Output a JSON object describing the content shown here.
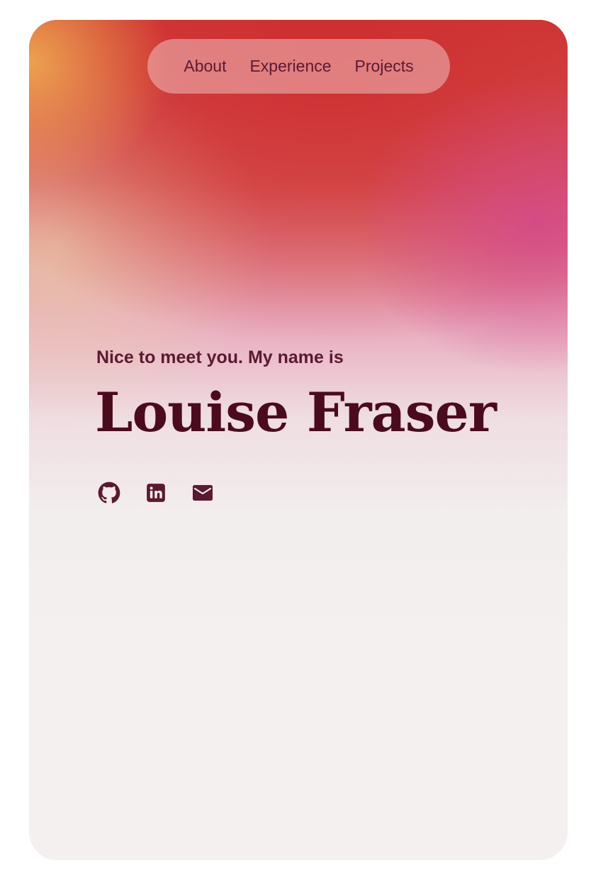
{
  "nav": {
    "items": [
      {
        "label": "About"
      },
      {
        "label": "Experience"
      },
      {
        "label": "Projects"
      }
    ]
  },
  "hero": {
    "greeting": "Nice to meet you. My name is",
    "name": "Louise Fraser"
  },
  "socials": {
    "icons": [
      "github-icon",
      "linkedin-icon",
      "email-icon"
    ]
  },
  "colors": {
    "accent": "#4a0b1f",
    "card_background": "#f3f0ef"
  }
}
